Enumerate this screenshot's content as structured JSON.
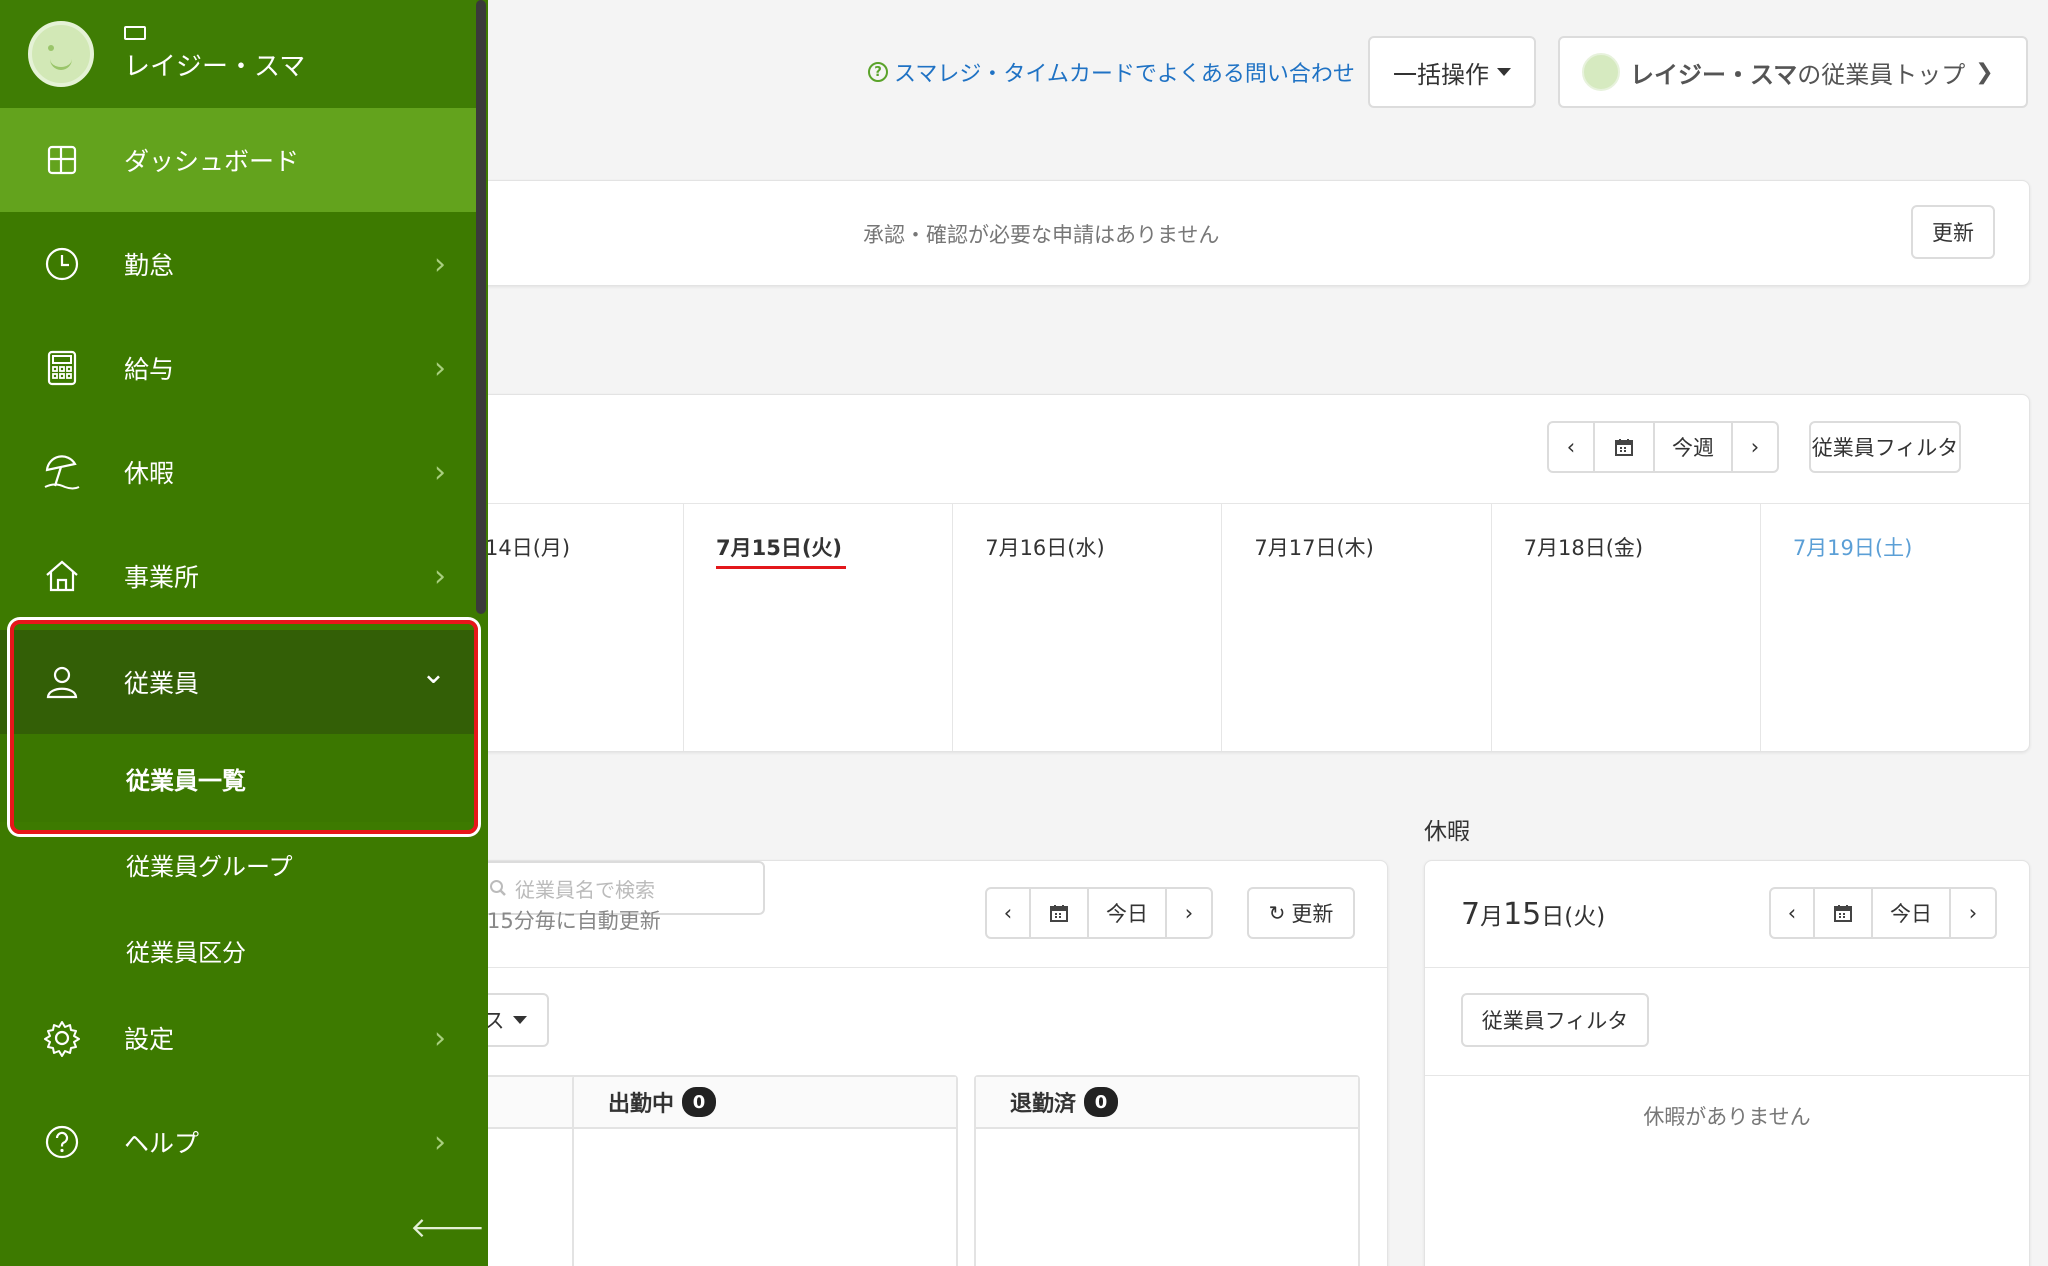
{
  "header": {
    "faq_icon": "?",
    "faq_link": "スマレジ・タイムカードでよくある問い合わせ",
    "bulk_button": "一括操作",
    "employee_top_name": "レイジー・スマ",
    "employee_top_suffix": "の従業員トップ",
    "employee_top_chevron": "❯"
  },
  "approval": {
    "message": "承認・確認が必要な申請はありません",
    "refresh_label": "更新"
  },
  "week": {
    "prev": "‹",
    "next": "›",
    "current_label": "今週",
    "filter_label": "従業員フィルタ",
    "days": [
      "14日(月)",
      "7月15日(火)",
      "7月16日(水)",
      "7月17日(木)",
      "7月18日(金)",
      "7月19日(土)"
    ]
  },
  "attendance": {
    "auto_refresh": "15分毎に自動更新",
    "prev": "‹",
    "next": "›",
    "today_label": "今日",
    "refresh_label": "更新",
    "status_select": "ス",
    "search_placeholder": "従業員名で検索",
    "columns": [
      {
        "label": "",
        "count": ""
      },
      {
        "label": "出勤中",
        "count": "0"
      },
      {
        "label": "退勤済",
        "count": "0"
      }
    ]
  },
  "leave": {
    "section_title": "休暇",
    "date_month": "7",
    "date_month_unit": "月",
    "date_day": "15",
    "date_day_unit": "日(火)",
    "prev": "‹",
    "next": "›",
    "today_label": "今日",
    "filter_label": "従業員フィルタ",
    "empty_message": "休暇がありません"
  },
  "sidebar": {
    "user_name": "レイジー・スマ",
    "items": [
      {
        "label": "ダッシュボード",
        "icon": "dashboard-icon"
      },
      {
        "label": "勤怠",
        "icon": "clock-icon"
      },
      {
        "label": "給与",
        "icon": "calculator-icon"
      },
      {
        "label": "休暇",
        "icon": "beach-umbrella-icon"
      },
      {
        "label": "事業所",
        "icon": "home-icon"
      },
      {
        "label": "従業員",
        "icon": "user-icon"
      },
      {
        "label": "設定",
        "icon": "gear-icon"
      },
      {
        "label": "ヘルプ",
        "icon": "help-icon"
      }
    ],
    "chevron": "›",
    "open_chevron": "⌄",
    "sub_items": [
      "従業員一覧",
      "従業員グループ",
      "従業員区分"
    ],
    "collapse_label": "🡐"
  },
  "colors": {
    "sidebar": "#3d7a00",
    "sidebar_active": "#63a31d",
    "highlight": "#e8161b",
    "link": "#1f72c4",
    "saturday": "#5b9fd6"
  }
}
